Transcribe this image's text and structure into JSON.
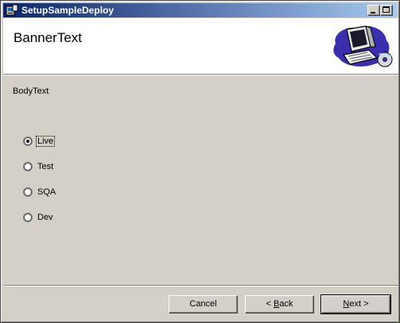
{
  "window": {
    "title": "SetupSampleDeploy"
  },
  "banner": {
    "title": "BannerText",
    "art_icon": "computer-setup-icon"
  },
  "body": {
    "text": "BodyText"
  },
  "options": [
    {
      "label": "Live",
      "selected": true
    },
    {
      "label": "Test",
      "selected": false
    },
    {
      "label": "SQA",
      "selected": false
    },
    {
      "label": "Dev",
      "selected": false
    }
  ],
  "buttons": {
    "cancel": "Cancel",
    "back_mnemonic": "B",
    "back_rest": "ack",
    "back_arrow": "<",
    "next_mnemonic": "N",
    "next_rest": "ext",
    "next_arrow": ">"
  },
  "colors": {
    "titlebar_start": "#0a246a",
    "titlebar_end": "#a6caf0",
    "face": "#d4d0c8"
  }
}
